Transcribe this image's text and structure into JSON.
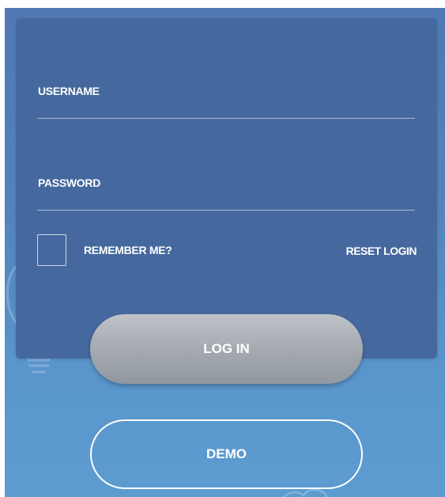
{
  "form": {
    "username_label": "USERNAME",
    "password_label": "PASSWORD",
    "remember_label": "REMEMBER ME?",
    "remember_checked": false,
    "reset_label": "RESET LOGIN"
  },
  "buttons": {
    "login_label": "LOG IN",
    "demo_label": "DEMO"
  },
  "colors": {
    "background_top": "#4f78b4",
    "background_bottom": "#5c9bd0",
    "card": "#45699e",
    "login_button": "#a3a8ae",
    "text": "#ffffff"
  },
  "icons": {
    "background_decoration": "lightbulb-icon",
    "bottom_decoration": "cloud-icon"
  }
}
